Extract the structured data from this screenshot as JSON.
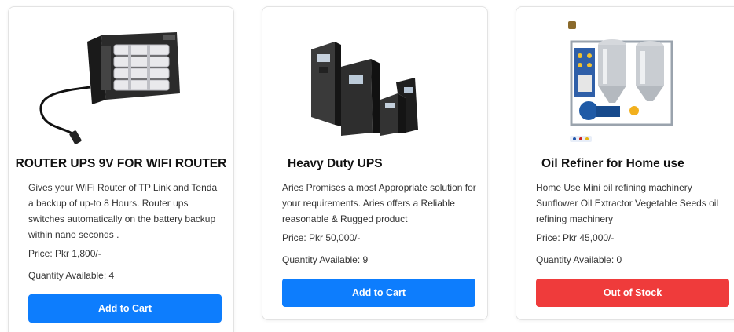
{
  "colors": {
    "primary_button": "#0d7dfd",
    "danger_button": "#ef3b3b"
  },
  "products": [
    {
      "image_icon": "router-ups-battery-icon",
      "title": "ROUTER UPS 9V FOR WIFI ROUTER",
      "description": "Gives your WiFi Router of TP Link and Tenda a backup of up-to 8 Hours. Router ups switches automatically on the battery backup within nano seconds .",
      "price": "Price: Pkr 1,800/-",
      "quantity": "Quantity Available: 4",
      "button": "Add to Cart"
    },
    {
      "image_icon": "ups-towers-icon",
      "title": "Heavy Duty UPS",
      "description": "Aries Promises a most Appropriate solution for your requirements. Aries offers a Reliable reasonable & Rugged product",
      "price": "Price: Pkr 50,000/-",
      "quantity": "Quantity Available: 9",
      "button": "Add to Cart"
    },
    {
      "image_icon": "oil-refiner-machine-icon",
      "title": "Oil Refiner for Home use",
      "description": "Home Use Mini oil refining machinery Sunflower Oil Extractor Vegetable Seeds oil refining machinery",
      "price": "Price: Pkr 45,000/-",
      "quantity": "Quantity Available: 0",
      "button": "Out of Stock"
    }
  ]
}
